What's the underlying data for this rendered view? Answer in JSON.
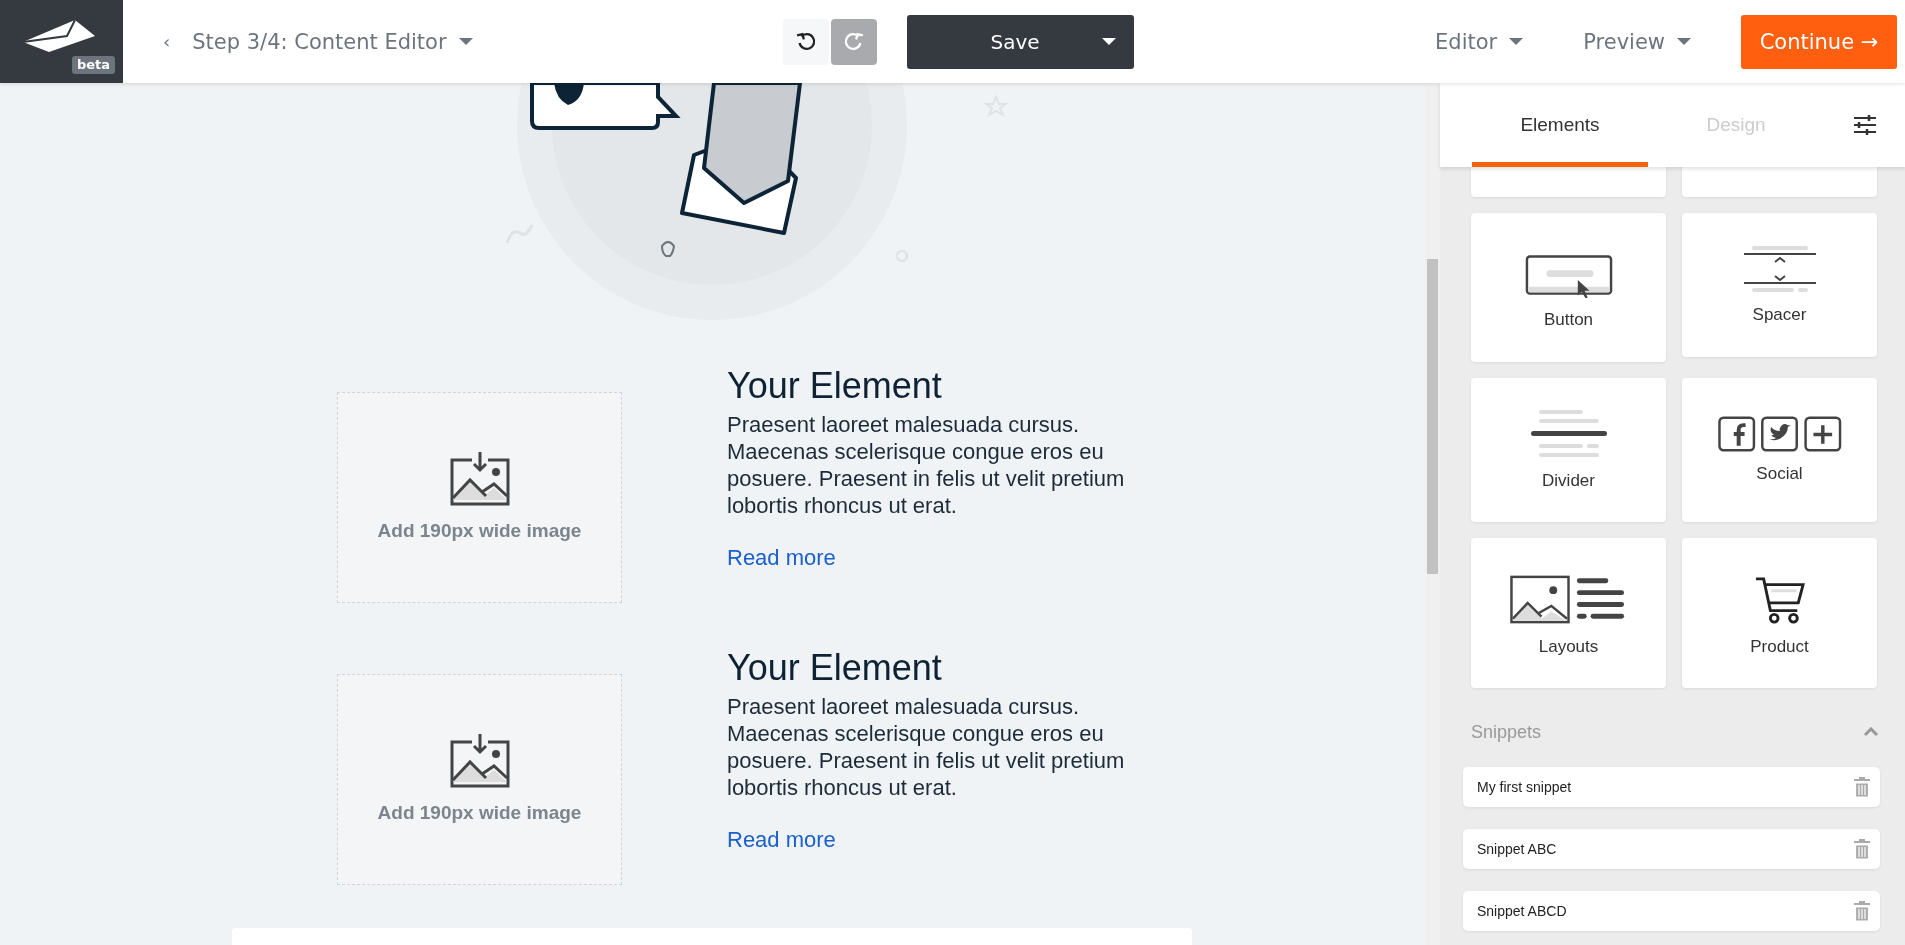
{
  "header": {
    "logo_badge": "beta",
    "back": "‹",
    "step": "Step 3/4: Content Editor",
    "undo": {
      "disabled": false
    },
    "redo": {
      "disabled": true
    },
    "save": "Save",
    "menus": [
      {
        "label": "Editor"
      },
      {
        "label": "Preview"
      }
    ],
    "continue": "Continue →"
  },
  "canvas": {
    "blocks": [
      {
        "image_hint": "Add 190px wide image",
        "title": "Your Element",
        "text": "Praesent laoreet malesuada cursus. Maecenas scelerisque congue eros eu posuere. Praesent in felis ut velit pretium lobortis rhoncus ut erat.",
        "link": "Read more"
      },
      {
        "image_hint": "Add 190px wide image",
        "title": "Your Element",
        "text": "Praesent laoreet malesuada cursus. Maecenas scelerisque congue eros eu posuere. Praesent in felis ut velit pretium lobortis rhoncus ut erat.",
        "link": "Read more"
      }
    ]
  },
  "panel": {
    "tabs": [
      {
        "label": "Elements",
        "selected": true
      },
      {
        "label": "Design",
        "selected": false
      }
    ],
    "elements": [
      {
        "label": "Button",
        "kind": "button"
      },
      {
        "label": "Spacer",
        "kind": "spacer"
      },
      {
        "label": "Divider",
        "kind": "divider"
      },
      {
        "label": "Social",
        "kind": "social"
      },
      {
        "label": "Layouts",
        "kind": "layouts"
      },
      {
        "label": "Product",
        "kind": "product"
      }
    ],
    "snippets": {
      "title": "Snippets",
      "expanded": true,
      "items": [
        {
          "label": "My first snippet"
        },
        {
          "label": "Snippet ABC"
        },
        {
          "label": "Snippet ABCD"
        }
      ]
    }
  }
}
